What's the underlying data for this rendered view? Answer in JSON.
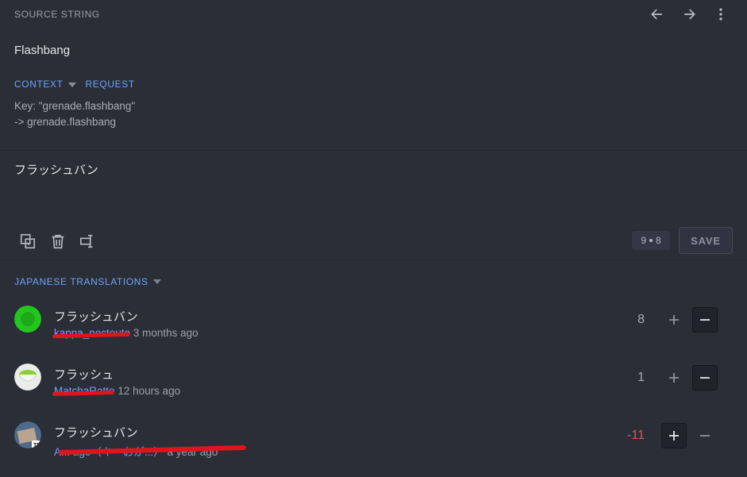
{
  "header": {
    "title": "SOURCE STRING",
    "actions": [
      "arrow-left-icon",
      "arrow-right-icon",
      "more-vertical-icon"
    ]
  },
  "source": {
    "text": "Flashbang",
    "tabs": [
      {
        "label": "CONTEXT",
        "has_dropdown": true
      },
      {
        "label": "REQUEST",
        "has_dropdown": false
      }
    ],
    "context_lines": [
      "Key: \"grenade.flashbang\"",
      "-> grenade.flashbang"
    ]
  },
  "editor": {
    "text": "フラッシュバン",
    "tools": [
      "copy-source-icon",
      "delete-icon",
      "text-cursor-icon"
    ],
    "counter": {
      "left": "9",
      "right": "8"
    },
    "save_label": "SAVE"
  },
  "translations": {
    "section_label": "JAPANESE TRANSLATIONS",
    "items": [
      {
        "text": "フラッシュバン",
        "user": "kappa_nectouto",
        "time": "3 months ago",
        "score": "8",
        "vote": "down"
      },
      {
        "text": "フラッシュ",
        "user": "MatchaRatte",
        "time": "12 hours ago",
        "score": "1",
        "vote": "down"
      },
      {
        "text": "フラッシュバン",
        "user": "A... age（キ―おが...）",
        "time": "a year ago",
        "score": "-11",
        "vote": "up"
      }
    ]
  },
  "colors": {
    "background": "#2a2e37",
    "accent": "#6ea3ff",
    "negative": "#e0584f",
    "redaction": "#e1141b"
  }
}
